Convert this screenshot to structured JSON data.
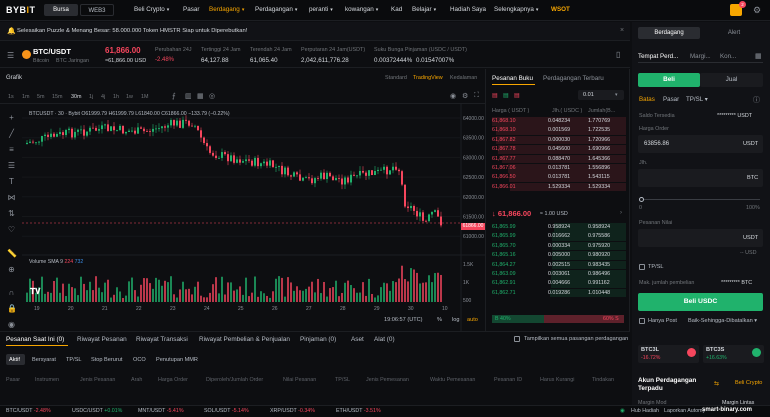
{
  "header": {
    "logo": "BYB",
    "logo_accent": "I",
    "logo_tail": "T",
    "seg_bursa": "Bursa",
    "seg_web3": "WEB3",
    "nav": [
      "Beli Crypto",
      "Pasar",
      "Berdagang",
      "Perdagangan",
      "peranti",
      "kowangan",
      "Kad",
      "Belajar",
      "Hadiah Saya",
      "Selengkapnya",
      "WSOT"
    ],
    "notif_count": "2"
  },
  "banner": {
    "text": "Selesaikan Puzzle & Menang Besar: 58.000.000 Token HMSTR Siap untuk Diperebutkan!"
  },
  "ticker": {
    "pair": "BTC/USDT",
    "sub1": "Bitcoin",
    "sub2": "BTC Jaringan",
    "price": "61,866.00",
    "price_usd": "≈61,866.00 USD",
    "change_label": "Perubahan 24J",
    "change": "-2.48%",
    "high_label": "Tertinggi 24 Jam",
    "high": "64,127.88",
    "low_label": "Terendah 24 Jam",
    "low": "61,065.40",
    "vol_label": "Perputaran 24 Jam(USDT)",
    "vol": "2,042,611,776.28",
    "rate_label": "Suku Bunga Pinjaman (USDC / USDT)",
    "rate1": "0.00372444%",
    "rate2": "0.01547007%"
  },
  "chart": {
    "tab": "Grafik",
    "views": [
      "Standard",
      "TradingView",
      "Kedalaman"
    ],
    "intervals": [
      "1s",
      "1m",
      "5m",
      "15m",
      "30m",
      "1j",
      "4j",
      "1h",
      "1w",
      "1M"
    ],
    "legend": "BTCUSDT · 30 · Bybit  O61999.79 H61999.79 L61840.00 C61866.00 −133.79 (−0.22%)",
    "price_tag": "61866.00",
    "y_ticks": [
      "64000.00",
      "63500.00",
      "63000.00",
      "62500.00",
      "62000.00",
      "61500.00",
      "61000.00"
    ],
    "vol_ticks": [
      "1.5K",
      "1K",
      "500"
    ],
    "vol_legend": "Volume SMA 9",
    "vol_a": "224",
    "vol_b": "732",
    "x_ticks": [
      "19",
      "20",
      "21",
      "22",
      "23",
      "24",
      "25",
      "26",
      "27",
      "28",
      "29",
      "30",
      "10"
    ],
    "time": "19:06:57 (UTC)",
    "pct": "%",
    "log": "log",
    "auto": "auto"
  },
  "orderbook": {
    "tab1": "Pesanan Buku",
    "tab2": "Perdagangan Terbaru",
    "precision": "0.01",
    "hdr_price": "Harga ( USDT )",
    "hdr_qty": "Jlh.( USDC )",
    "hdr_total": "Jumlah(B...",
    "asks": [
      [
        "61,868.10",
        "0.048234",
        "1.770769"
      ],
      [
        "61,868.10",
        "0.001569",
        "1.722535"
      ],
      [
        "61,867.82",
        "0.000030",
        "1.720966"
      ],
      [
        "61,867.78",
        "0.045600",
        "1.690966"
      ],
      [
        "61,867.77",
        "0.088470",
        "1.645366"
      ],
      [
        "61,867.06",
        "0.013781",
        "1.556896"
      ],
      [
        "61,866.50",
        "0.013781",
        "1.543115"
      ],
      [
        "61,866.01",
        "1.529334",
        "1.529334"
      ]
    ],
    "mid": "61,866.00",
    "mid_usd": "≈ 1.00 USD",
    "bids": [
      [
        "61,865.99",
        "0.958924",
        "0.958924"
      ],
      [
        "61,865.99",
        "0.016662",
        "0.975586"
      ],
      [
        "61,865.70",
        "0.000334",
        "0.975920"
      ],
      [
        "61,865.16",
        "0.005000",
        "0.980920"
      ],
      [
        "61,864.27",
        "0.002515",
        "0.983435"
      ],
      [
        "61,863.09",
        "0.003061",
        "0.986496"
      ],
      [
        "61,862.91",
        "0.004666",
        "0.991162"
      ],
      [
        "61,862.71",
        "0.019286",
        "1.010448"
      ]
    ],
    "buy_pct": "40%",
    "sell_pct": "60%"
  },
  "order": {
    "tab_trade": "Berdagang",
    "tab_alert": "Alert",
    "types": [
      "Tempat Perd...",
      "Margi...",
      "Kon..."
    ],
    "buy": "Beli",
    "sell": "Jual",
    "otypes": [
      "Batas",
      "Pasar",
      "TP/SL"
    ],
    "balance_label": "Saldo Tersedia",
    "balance": "********* USDT",
    "price_label": "Harga Order",
    "price": "63856.86",
    "ccy_usdt": "USDT",
    "qty_label": "Jlh.",
    "ccy_btc": "BTC",
    "slider_min": "0",
    "slider_max": "100%",
    "value_label": "Pesanan Nilai",
    "approx": "-- USD",
    "tpsl": "TP/SL",
    "max_label": "Mak. jumlah pembelian",
    "max_val": "********* BTC",
    "submit": "Beli USDC",
    "post": "Hanya Post",
    "tif": "Baik-Sehingga-Dibatalkan"
  },
  "widgets": {
    "btc3l": "BTC3L",
    "btc3l_chg": "-16.72%",
    "btc3s": "BTC3S",
    "btc3s_chg": "+16.63%",
    "acct": "Akun Perdagangan Terpadu",
    "buy_crypto": "Beli Crypto",
    "margin": "Margin Mod",
    "margin_val": "Margin Lintas"
  },
  "bottom": {
    "tabs": [
      "Pesanan Saat Ini (0)",
      "Riwayat Pesanan",
      "Riwayat Transaksi",
      "Riwayat Pembelian & Penjualan",
      "Pinjaman (0)",
      "Aset",
      "Alat (0)"
    ],
    "show_all": "Tampilkan semua pasangan perdagangan",
    "subtabs": [
      "Aktif",
      "Bersyarat",
      "TP/SL",
      "Stop Berurut",
      "OCO",
      "Penutupan MMR"
    ],
    "cols": [
      "Pasar",
      "Instrumen",
      "Jenis Pesanan",
      "Arah",
      "Harga Order",
      "Diperoleh/Jumlah Order",
      "Nilai Pesanan",
      "TP/SL",
      "Jenis Pemesanan",
      "Waktu Pemesanan",
      "Pesanan ID",
      "Harus Kurangi",
      "Tindakan"
    ]
  },
  "footer": {
    "items": [
      [
        "BTC/USDT",
        "-2.48%"
      ],
      [
        "USDC/USDT",
        "+0.01%"
      ],
      [
        "MNT/USDT",
        "-5.41%"
      ],
      [
        "SOL/USDT",
        "-5.14%"
      ],
      [
        "XRP/USDT",
        "-0.34%"
      ],
      [
        "ETH/USDT",
        "-3.51%"
      ]
    ],
    "help": "Hub Hadiah",
    "support": "Laporkan Automy",
    "watermark": "smart-binary.com"
  }
}
